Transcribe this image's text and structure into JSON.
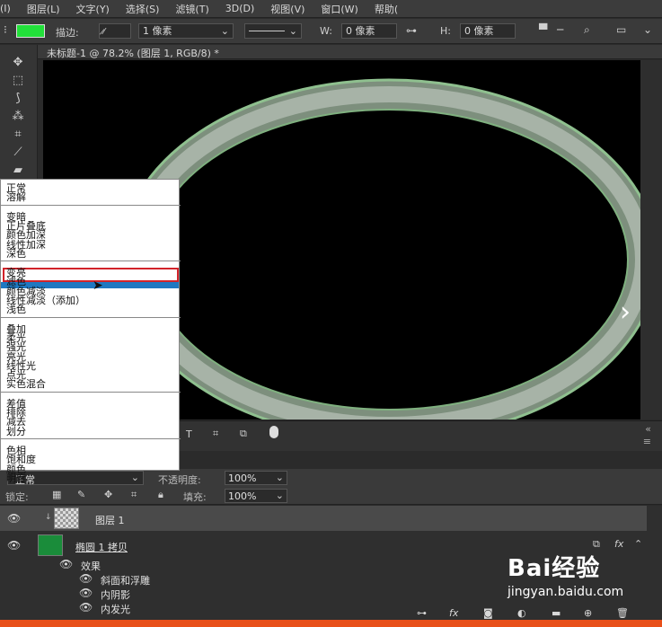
{
  "menubar": {
    "items": [
      "(I)",
      "图层(L)",
      "文字(Y)",
      "选择(S)",
      "滤镜(T)",
      "3D(D)",
      "视图(V)",
      "窗口(W)",
      "帮助("
    ]
  },
  "options": {
    "stroke_label": "描边:",
    "stroke_width": "1 像素",
    "w_label": "W:",
    "w_value": "0 像素",
    "h_label": "H:",
    "h_value": "0 像素",
    "fill_color": "#22e03a"
  },
  "document": {
    "tab_title": "未标题-1 @ 78.2% (图层 1, RGB/8) *"
  },
  "blend_menu": {
    "groups": [
      [
        "正常",
        "溶解"
      ],
      [
        "变暗",
        "正片叠底",
        "颜色加深",
        "线性加深",
        "深色"
      ],
      [
        "变亮",
        "滤色",
        "颜色减淡",
        "线性减淡（添加）",
        "浅色"
      ],
      [
        "叠加",
        "柔光",
        "强光",
        "亮光",
        "线性光",
        "点光",
        "实色混合"
      ],
      [
        "差值",
        "排除",
        "减去",
        "划分"
      ],
      [
        "色相",
        "饱和度",
        "颜色",
        "明度"
      ]
    ],
    "highlighted": "滤色",
    "hovered": "颜色减淡"
  },
  "layers_panel": {
    "blend_mode": "正常",
    "opacity_label": "不透明度:",
    "opacity_value": "100%",
    "lock_label": "锁定:",
    "fill_label": "填充:",
    "fill_value": "100%",
    "layers": [
      {
        "name": "图层 1"
      },
      {
        "name": "椭圆 1 拷贝",
        "fx": "fx"
      }
    ],
    "effects_label": "效果",
    "effects": [
      "斜面和浮雕",
      "内阴影",
      "内发光"
    ]
  },
  "watermark": {
    "brand": "Bai经验",
    "url": "jingyan.baidu.com"
  },
  "colors": {
    "accent_highlight": "#d2232a",
    "hover_blue": "#1f78c1",
    "status_orange": "#e8501a"
  }
}
